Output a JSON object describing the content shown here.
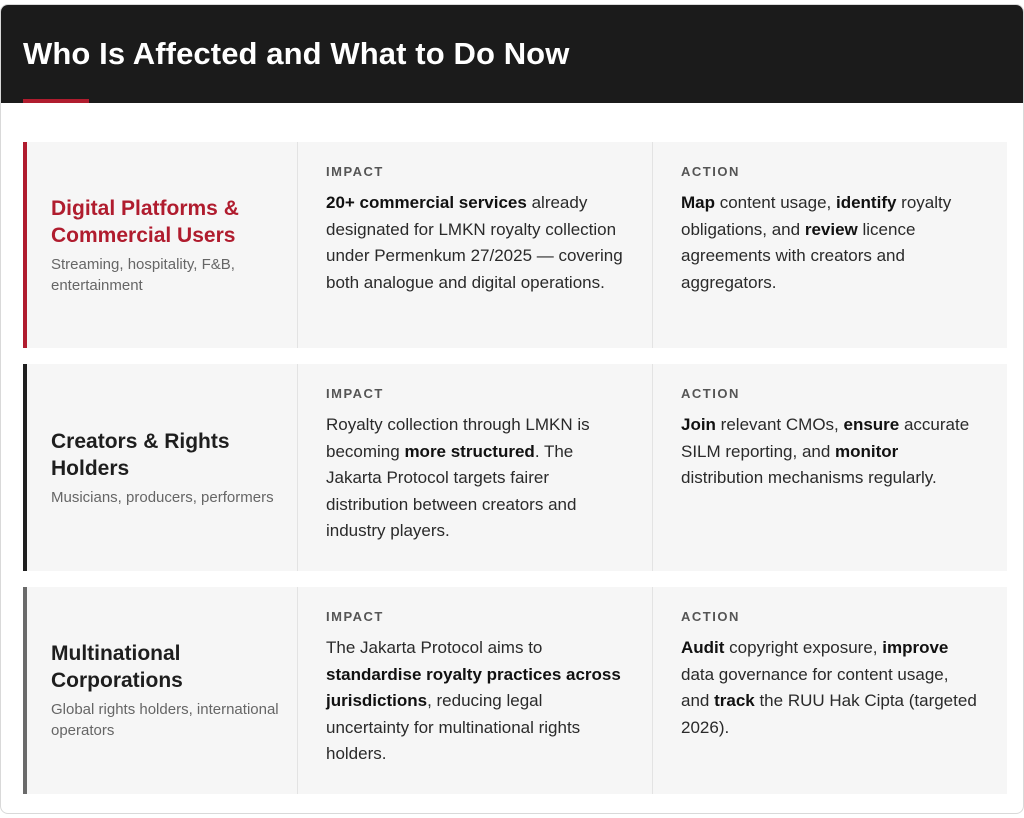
{
  "title": "Who Is Affected and What to Do Now",
  "colors": {
    "accent": "#b01c2e",
    "header_bg": "#1b1b1b",
    "row_bg": "#f6f6f6"
  },
  "rows": [
    {
      "name": "Digital Platforms & Commercial Users",
      "sub": "Streaming, hospitality, F&B, entertainment",
      "impact_label": "IMPACT",
      "impact": [
        {
          "t": "20+ commercial services",
          "b": true
        },
        {
          "t": " already designated for LMKN royalty collection under Permenkum 27/2025 — covering both analogue and digital operations.",
          "b": false
        }
      ],
      "action_label": "ACTION",
      "action": [
        {
          "t": "Map",
          "b": true
        },
        {
          "t": " content usage, ",
          "b": false
        },
        {
          "t": "identify",
          "b": true
        },
        {
          "t": " royalty obligations, and ",
          "b": false
        },
        {
          "t": "review",
          "b": true
        },
        {
          "t": " licence agreements with creators and aggregators.",
          "b": false
        }
      ]
    },
    {
      "name": "Creators & Rights Holders",
      "sub": "Musicians, producers, performers",
      "impact_label": "IMPACT",
      "impact": [
        {
          "t": "Royalty collection through LMKN is becoming ",
          "b": false
        },
        {
          "t": "more structured",
          "b": true
        },
        {
          "t": ". The Jakarta Protocol targets fairer distribution between creators and industry players.",
          "b": false
        }
      ],
      "action_label": "ACTION",
      "action": [
        {
          "t": "Join",
          "b": true
        },
        {
          "t": " relevant CMOs, ",
          "b": false
        },
        {
          "t": "ensure",
          "b": true
        },
        {
          "t": " accurate SILM reporting, and ",
          "b": false
        },
        {
          "t": "monitor",
          "b": true
        },
        {
          "t": " distribution mechanisms regularly.",
          "b": false
        }
      ]
    },
    {
      "name": "Multinational Corporations",
      "sub": "Global rights holders, international operators",
      "impact_label": "IMPACT",
      "impact": [
        {
          "t": "The Jakarta Protocol aims to ",
          "b": false
        },
        {
          "t": "standardise royalty practices across jurisdictions",
          "b": true
        },
        {
          "t": ", reducing legal uncertainty for multinational rights holders.",
          "b": false
        }
      ],
      "action_label": "ACTION",
      "action": [
        {
          "t": "Audit",
          "b": true
        },
        {
          "t": " copyright exposure, ",
          "b": false
        },
        {
          "t": "improve",
          "b": true
        },
        {
          "t": " data governance for content usage, and ",
          "b": false
        },
        {
          "t": "track",
          "b": true
        },
        {
          "t": " the RUU Hak Cipta (targeted 2026).",
          "b": false
        }
      ]
    }
  ]
}
